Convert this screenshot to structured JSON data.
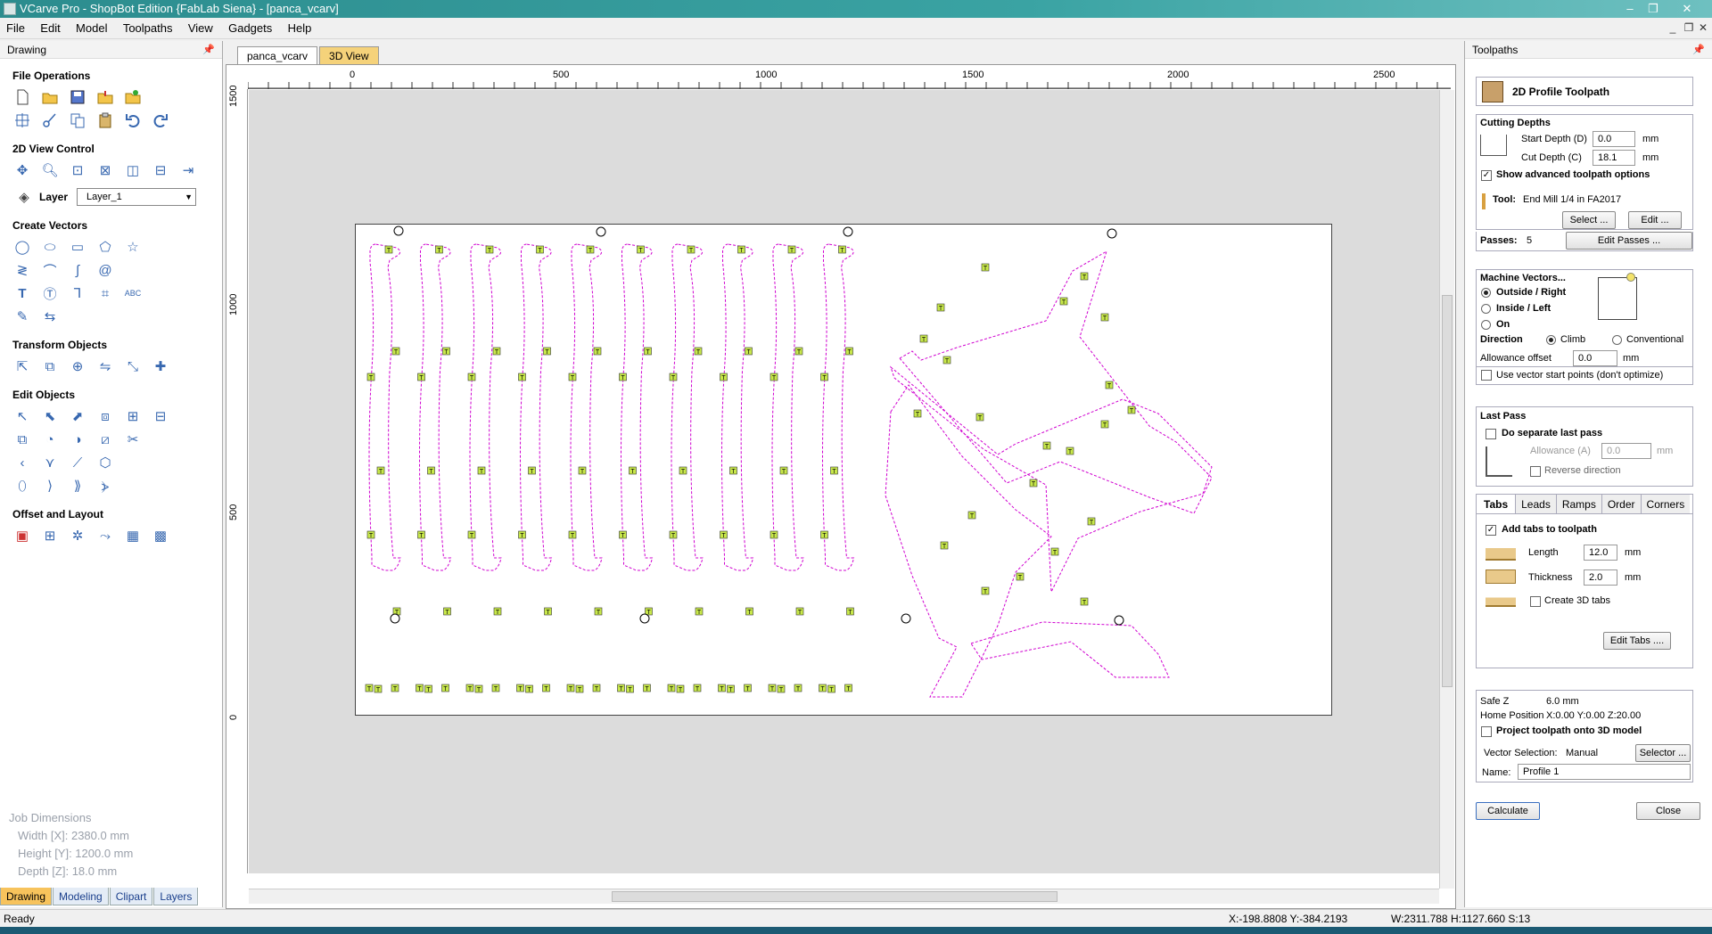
{
  "app": {
    "title": "VCarve Pro - ShopBot Edition {FabLab Siena} - [panca_vcarv]"
  },
  "menu": [
    "File",
    "Edit",
    "Model",
    "Toolpaths",
    "View",
    "Gadgets",
    "Help"
  ],
  "left_panel": {
    "title": "Drawing",
    "sections": {
      "file_ops": "File Operations",
      "view_control": "2D View Control",
      "create_vectors": "Create Vectors",
      "transform": "Transform Objects",
      "edit_objects": "Edit Objects",
      "offset_layout": "Offset and Layout"
    },
    "layer_label": "Layer",
    "layer_value": "Layer_1",
    "job_dimensions": {
      "heading": "Job Dimensions",
      "width": "Width  [X]: 2380.0 mm",
      "height": "Height [Y]: 1200.0 mm",
      "depth": "Depth  [Z]: 18.0 mm"
    },
    "bottom_tabs": [
      "Drawing",
      "Modeling",
      "Clipart",
      "Layers"
    ]
  },
  "doc_tabs": [
    "panca_vcarv",
    "3D View"
  ],
  "ruler": {
    "h_labels": [
      "0",
      "500",
      "1000",
      "1500",
      "2000",
      "2500"
    ],
    "v_labels": [
      "1500",
      "1000",
      "500",
      "0"
    ]
  },
  "toolpath_panel": {
    "title": "Toolpaths",
    "header": "2D Profile Toolpath",
    "cutting_depths": "Cutting Depths",
    "start_depth_label": "Start Depth (D)",
    "start_depth": "0.0",
    "cut_depth_label": "Cut Depth (C)",
    "cut_depth": "18.1",
    "unit": "mm",
    "show_advanced": "Show advanced toolpath options",
    "tool_label": "Tool:",
    "tool_name": "End Mill 1/4 in FA2017",
    "select_btn": "Select ...",
    "edit_btn": "Edit ...",
    "passes_label": "Passes:",
    "passes": "5",
    "edit_passes_btn": "Edit Passes ...",
    "machine_vectors": "Machine Vectors...",
    "outside": "Outside / Right",
    "inside": "Inside / Left",
    "on": "On",
    "direction": "Direction",
    "climb": "Climb",
    "conventional": "Conventional",
    "allowance_label": "Allowance offset",
    "allowance": "0.0",
    "vector_start": "Use vector start points (don't optimize)",
    "last_pass": "Last Pass",
    "separate_last": "Do separate last pass",
    "allowance_a": "Allowance (A)",
    "allowance_a_val": "0.0",
    "reverse": "Reverse direction",
    "tabs": [
      "Tabs",
      "Leads",
      "Ramps",
      "Order",
      "Corners"
    ],
    "add_tabs": "Add tabs to toolpath",
    "length_label": "Length",
    "length": "12.0",
    "thickness_label": "Thickness",
    "thickness": "2.0",
    "create_3d_tabs": "Create 3D tabs",
    "edit_tabs_btn": "Edit Tabs ....",
    "safe_z_label": "Safe Z",
    "safe_z": "6.0 mm",
    "home_label": "Home Position",
    "home": "X:0.00 Y:0.00 Z:20.00",
    "project": "Project toolpath onto 3D model",
    "vector_sel_label": "Vector Selection:",
    "vector_sel": "Manual",
    "selector_btn": "Selector ...",
    "name_label": "Name:",
    "name": "Profile 1",
    "calculate": "Calculate",
    "close": "Close"
  },
  "status": {
    "left": "Ready",
    "coords": "X:-198.8808 Y:-384.2193",
    "dims": "W:2311.788  H:1127.660  S:13"
  },
  "colors": {
    "toolpath": "#d000d0",
    "tab": "#c8e84a",
    "accent_tab": "#f7c35c"
  }
}
